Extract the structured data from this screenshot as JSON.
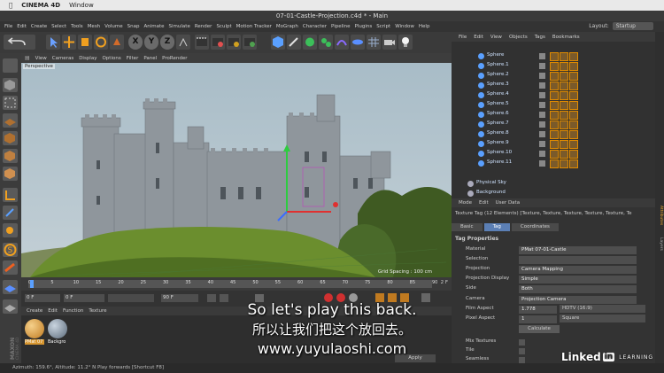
{
  "mac": {
    "apple": "",
    "app": "CINEMA 4D",
    "menu": "Window"
  },
  "window_title": "07-01-Castle-Projection.c4d * - Main",
  "menubar": [
    "File",
    "Edit",
    "Create",
    "Select",
    "Tools",
    "Mesh",
    "Volume",
    "Snap",
    "Animate",
    "Simulate",
    "Render",
    "Sculpt",
    "Motion Tracker",
    "MoGraph",
    "Character",
    "Pipeline",
    "Plugins",
    "Script",
    "Window",
    "Help"
  ],
  "layout": {
    "label": "Layout:",
    "value": "Startup"
  },
  "viewport": {
    "menu": [
      "View",
      "Cameras",
      "Display",
      "Options",
      "Filter",
      "Panel",
      "ProRender"
    ],
    "label": "Perspective",
    "grid_spacing": "Grid Spacing : 100 cm"
  },
  "timeline": {
    "ticks": [
      "0",
      "5",
      "10",
      "15",
      "20",
      "25",
      "30",
      "35",
      "40",
      "45",
      "50",
      "55",
      "60",
      "65",
      "70",
      "75",
      "80",
      "85",
      "90"
    ],
    "end": "2 F"
  },
  "playback": {
    "current": "0 F",
    "start": "0 F",
    "min": "90 F",
    "max": "90 F"
  },
  "material_menu": [
    "Create",
    "Edit",
    "Function",
    "Texture"
  ],
  "materials": [
    {
      "label": "PMat 07",
      "color": "#d7962f"
    },
    {
      "label": "Backgro",
      "color": "#8fa2b8"
    }
  ],
  "status": "Azimuth: 159.6°, Altitude: 11.2° N     Play forwards [Shortcut F8]",
  "object_manager": {
    "menu": [
      "File",
      "Edit",
      "View",
      "Objects",
      "Tags",
      "Bookmarks"
    ],
    "objects": [
      "Sphere",
      "Sphere.1",
      "Sphere.2",
      "Sphere.3",
      "Sphere.4",
      "Sphere.5",
      "Sphere.6",
      "Sphere.7",
      "Sphere.8",
      "Sphere.9",
      "Sphere.10",
      "Sphere.11"
    ],
    "extra": [
      "Physical Sky",
      "Background"
    ]
  },
  "attribute_manager": {
    "menu": [
      "Mode",
      "Edit",
      "User Data"
    ],
    "header": "Texture Tag (12 Elements) [Texture, Texture, Texture, Texture, Texture, Te",
    "tabs": [
      "Basic",
      "Tag",
      "Coordinates"
    ],
    "section": "Tag Properties",
    "rows": [
      {
        "k": "Material",
        "v": "PMat 07-01-Castle"
      },
      {
        "k": "Selection",
        "v": ""
      },
      {
        "k": "Projection",
        "v": "Camera Mapping"
      },
      {
        "k": "Projection Display",
        "v": "Simple"
      },
      {
        "k": "Side",
        "v": "Both"
      },
      {
        "k": "Camera",
        "v": "Projection Camera"
      },
      {
        "k": "Film Aspect",
        "v": "1.778"
      },
      {
        "k": "Pixel Aspect",
        "v": "1"
      }
    ],
    "film_preset": "HDTV (16:9)",
    "pixel_preset": "Square",
    "calculate": "Calculate",
    "bottom": [
      "Mix Textures",
      "Tile",
      "Seamless"
    ],
    "apply": "Apply"
  },
  "right_tabs": [
    "Attributes",
    "Layers"
  ],
  "subtitles": {
    "en": "So let's play this back.",
    "zh": "所以让我们把这个放回去。",
    "url": "www.yuyulaoshi.com"
  },
  "brand": {
    "name": "Linked",
    "in": "in",
    "suffix": "LEARNING"
  }
}
